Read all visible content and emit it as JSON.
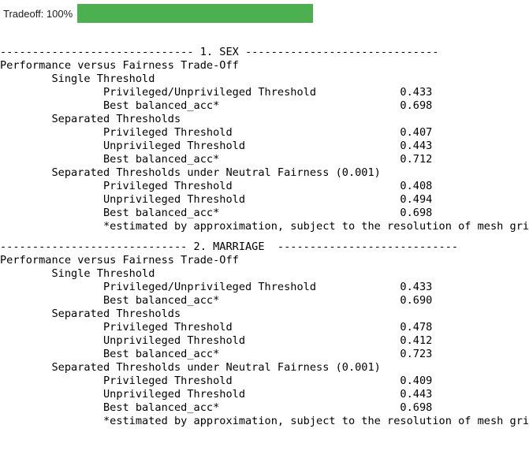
{
  "progress": {
    "label": "Tradeoff: 100%",
    "percent": 100,
    "fill_color": "#4caf50",
    "track_color": "#ffffff"
  },
  "report": {
    "subtitle": "Performance versus Fairness Trade-Off",
    "footnote": "*estimated by approximation, subject to the resolution of mesh grid",
    "separator_dash": "-",
    "sections": [
      {
        "index": "1.",
        "name": "SEX",
        "header_line": "------------------------------ 1. SEX ------------------------------",
        "subtitle": "Performance versus Fairness Trade-Off",
        "groups": [
          {
            "title": "Single Threshold",
            "title_line": "        Single Threshold",
            "rows": [
              {
                "label": "Privileged/Unprivileged Threshold",
                "value": "0.433",
                "line": "                Privileged/Unprivileged Threshold             0.433"
              },
              {
                "label": "Best balanced_acc*",
                "value": "0.698",
                "line": "                Best balanced_acc*                            0.698"
              }
            ]
          },
          {
            "title": "Separated Thresholds",
            "title_line": "        Separated Thresholds",
            "rows": [
              {
                "label": "Privileged Threshold",
                "value": "0.407",
                "line": "                Privileged Threshold                          0.407"
              },
              {
                "label": "Unprivileged Threshold",
                "value": "0.443",
                "line": "                Unprivileged Threshold                        0.443"
              },
              {
                "label": "Best balanced_acc*",
                "value": "0.712",
                "line": "                Best balanced_acc*                            0.712"
              }
            ]
          },
          {
            "title": "Separated Thresholds under Neutral Fairness (0.001)",
            "title_line": "        Separated Thresholds under Neutral Fairness (0.001)",
            "rows": [
              {
                "label": "Privileged Threshold",
                "value": "0.408",
                "line": "                Privileged Threshold                          0.408"
              },
              {
                "label": "Unprivileged Threshold",
                "value": "0.494",
                "line": "                Unprivileged Threshold                        0.494"
              },
              {
                "label": "Best balanced_acc*",
                "value": "0.698",
                "line": "                Best balanced_acc*                            0.698"
              }
            ]
          }
        ],
        "footnote_line": "                *estimated by approximation, subject to the resolution of mesh grid"
      },
      {
        "index": "2.",
        "name": "MARRIAGE",
        "header_line": "----------------------------- 2. MARRIAGE  ----------------------------",
        "subtitle": "Performance versus Fairness Trade-Off",
        "groups": [
          {
            "title": "Single Threshold",
            "title_line": "        Single Threshold",
            "rows": [
              {
                "label": "Privileged/Unprivileged Threshold",
                "value": "0.433",
                "line": "                Privileged/Unprivileged Threshold             0.433"
              },
              {
                "label": "Best balanced_acc*",
                "value": "0.690",
                "line": "                Best balanced_acc*                            0.690"
              }
            ]
          },
          {
            "title": "Separated Thresholds",
            "title_line": "        Separated Thresholds",
            "rows": [
              {
                "label": "Privileged Threshold",
                "value": "0.478",
                "line": "                Privileged Threshold                          0.478"
              },
              {
                "label": "Unprivileged Threshold",
                "value": "0.412",
                "line": "                Unprivileged Threshold                        0.412"
              },
              {
                "label": "Best balanced_acc*",
                "value": "0.723",
                "line": "                Best balanced_acc*                            0.723"
              }
            ]
          },
          {
            "title": "Separated Thresholds under Neutral Fairness (0.001)",
            "title_line": "        Separated Thresholds under Neutral Fairness (0.001)",
            "rows": [
              {
                "label": "Privileged Threshold",
                "value": "0.409",
                "line": "                Privileged Threshold                          0.409"
              },
              {
                "label": "Unprivileged Threshold",
                "value": "0.443",
                "line": "                Unprivileged Threshold                        0.443"
              },
              {
                "label": "Best balanced_acc*",
                "value": "0.698",
                "line": "                Best balanced_acc*                            0.698"
              }
            ]
          }
        ],
        "footnote_line": "                *estimated by approximation, subject to the resolution of mesh grid"
      }
    ]
  }
}
